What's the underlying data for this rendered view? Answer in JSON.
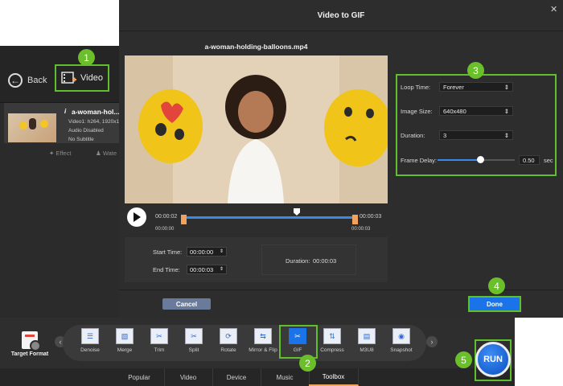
{
  "app": {
    "back_label": "Back",
    "video_label": "Video",
    "file_card": {
      "title": "a-woman-hol...",
      "video_info": "Video1: h264, 1920x1",
      "audio_info": "Audio Disabled",
      "subtitle_info": "No Subtitle",
      "effect_label": "Effect",
      "watermark_label": "Wate"
    }
  },
  "dialog": {
    "title": "Video to GIF",
    "file_name": "a-woman-holding-balloons.mp4",
    "timeline": {
      "current_left": "00:00:02",
      "start_mark": "00:00:00",
      "current_right": "00:00:03",
      "end_mark": "00:00:03"
    },
    "settings": {
      "loop_time_label": "Loop Time:",
      "loop_time_value": "Forever",
      "image_size_label": "Image Size:",
      "image_size_value": "640x480",
      "duration_label": "Duration:",
      "duration_value": "3",
      "frame_delay_label": "Frame Delay:",
      "frame_delay_value": "0.50",
      "frame_delay_unit": "sec",
      "frame_delay_level": 0.55
    },
    "time": {
      "start_label": "Start Time:",
      "start_value": "00:00:00",
      "end_label": "End Time:",
      "end_value": "00:00:03",
      "duration_label": "Duration:",
      "duration_value": "00:00:03"
    },
    "cancel_label": "Cancel",
    "done_label": "Done"
  },
  "toolbox": {
    "target_format_label": "Target Format",
    "tools": [
      "Denoise",
      "Merge",
      "Trim",
      "Split",
      "Rotate",
      "Mirror & Flip",
      "GIF",
      "Compress",
      "M3U8",
      "Snapshot"
    ],
    "tabs": [
      "Popular",
      "Video",
      "Device",
      "Music",
      "Toolbox"
    ],
    "active_tab": "Toolbox",
    "run_label": "RUN"
  },
  "callouts": [
    "1",
    "2",
    "3",
    "4",
    "5"
  ],
  "colors": {
    "highlight_green": "#5fbf2d",
    "accent_blue": "#1a73e8",
    "trim_orange": "#f0a35e"
  }
}
